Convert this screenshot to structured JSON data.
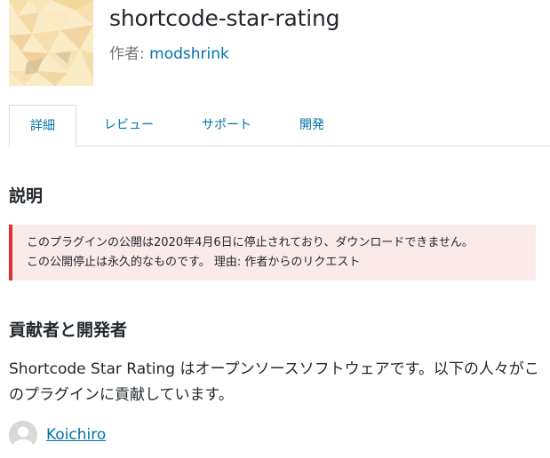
{
  "header": {
    "title": "shortcode-star-rating",
    "author_label": "作者: ",
    "author_name": "modshrink"
  },
  "tabs": [
    {
      "label": "詳細",
      "active": true
    },
    {
      "label": "レビュー",
      "active": false
    },
    {
      "label": "サポート",
      "active": false
    },
    {
      "label": "開発",
      "active": false
    }
  ],
  "description": {
    "heading": "説明",
    "notice_line1": "このプラグインの公開は2020年4月6日に停止されており、ダウンロードできません。",
    "notice_line2": "この公開停止は永久的なものです。 理由: 作者からのリクエスト"
  },
  "contributors": {
    "heading": "貢献者と開発者",
    "body": "Shortcode Star Rating はオープンソースソフトウェアです。以下の人々がこのプラグインに貢献しています。",
    "list": [
      {
        "name": "Koichiro"
      }
    ]
  },
  "colors": {
    "link": "#0073aa",
    "notice_bg": "#fbeaea",
    "notice_border": "#dc3232",
    "icon_bg": "#fbecc8"
  },
  "icons": {
    "plugin_icon": "plugin-banner-icon",
    "avatar": "default-avatar-icon"
  }
}
